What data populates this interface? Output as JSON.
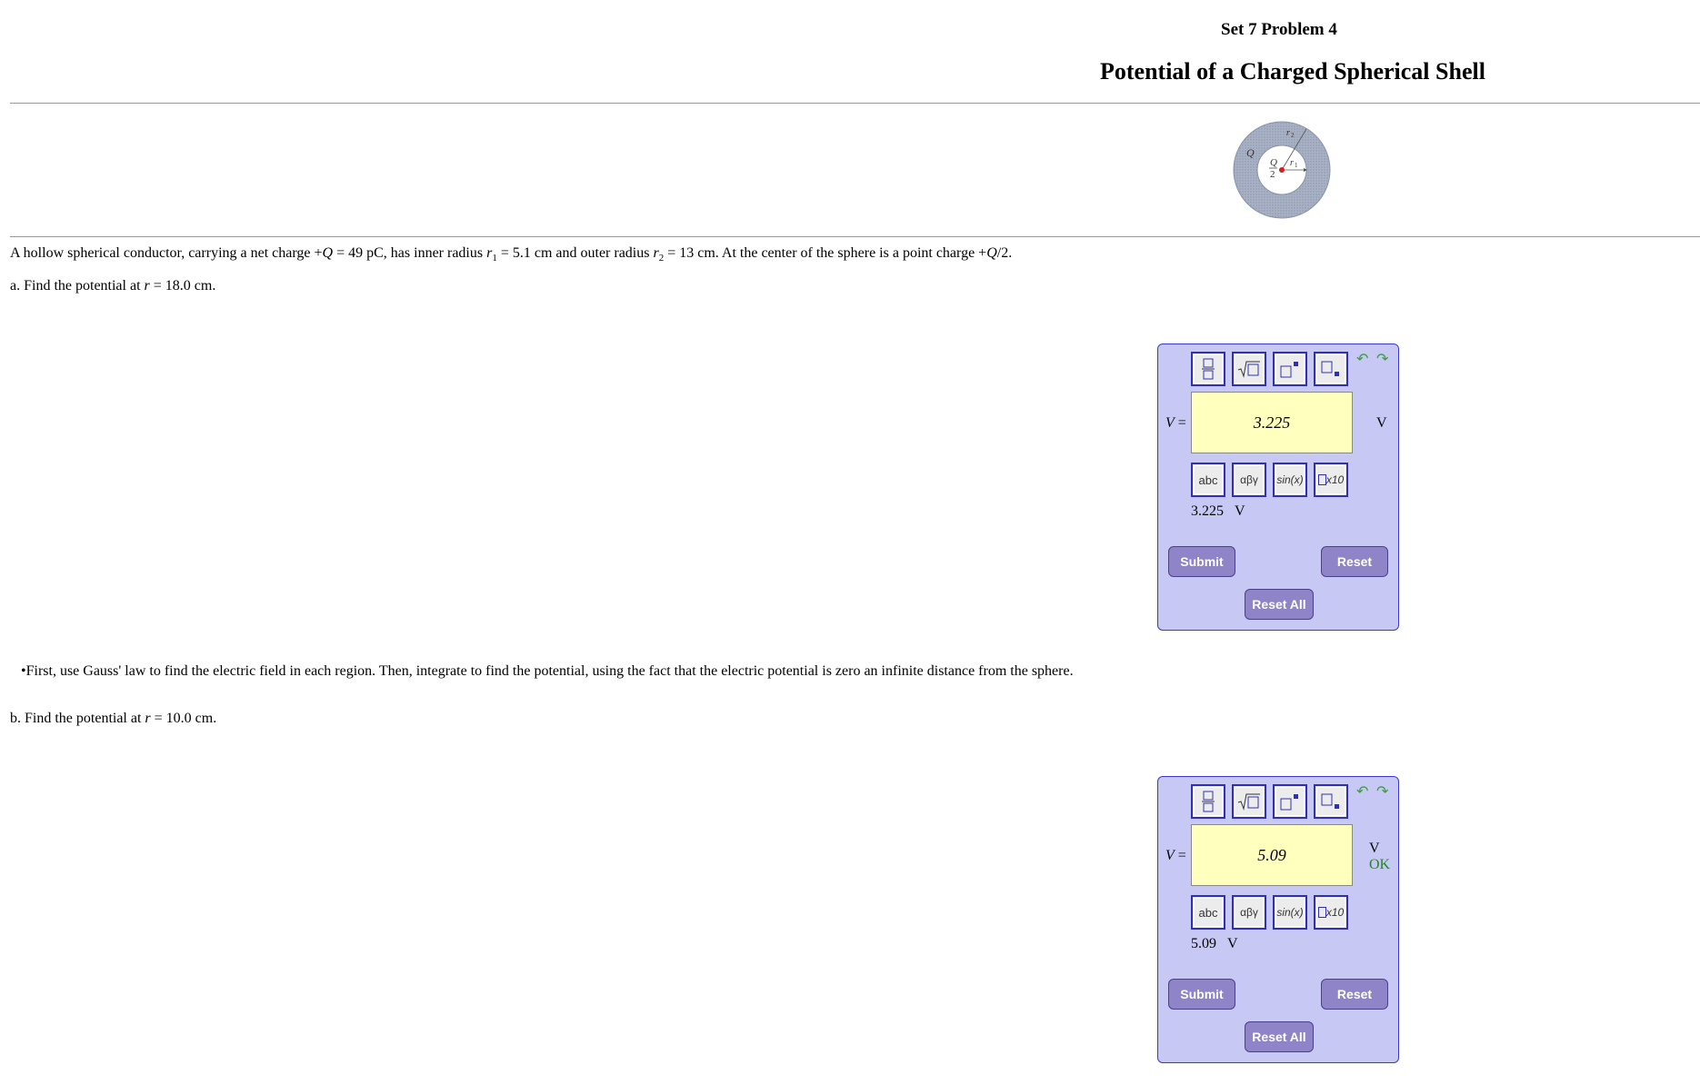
{
  "header": {
    "set_title": "Set 7 Problem 4",
    "main_title": "Potential of a Charged Spherical Shell"
  },
  "figure": {
    "label_q": "Q",
    "label_q_half_num": "Q",
    "label_q_half_den": "2",
    "label_r1": "r",
    "label_r1_sub": "1",
    "label_r2": "r",
    "label_r2_sub": "2"
  },
  "problem": {
    "p1": "A hollow spherical conductor, carrying a net charge +",
    "p2": "Q",
    "p3": " = 49 pC, has inner radius ",
    "p4": "r",
    "p5": "1",
    "p6": " = 5.1 cm and outer radius ",
    "p7": "r",
    "p8": "2",
    "p9": " = 13 cm. At the center of the sphere is a point charge +",
    "p10": "Q",
    "p11": "/2."
  },
  "part_a": {
    "prefix": "a. Find the potential at ",
    "var": "r",
    "suffix": " = 18.0 cm."
  },
  "hint": "•First, use Gauss' law to find the electric field in each region. Then, integrate to find the potential, using the fact that the electric potential is zero an infinite distance from the sphere.",
  "part_b": {
    "prefix": "b. Find the potential at ",
    "var": "r",
    "suffix": " = 10.0 cm."
  },
  "widget_a": {
    "var_label": "V",
    "equals": " =",
    "answer": "3.225",
    "unit": "V",
    "preview_value": "3.225",
    "preview_unit": "V",
    "status": ""
  },
  "widget_b": {
    "var_label": "V",
    "equals": " =",
    "answer": "5.09",
    "unit": "V",
    "preview_value": "5.09",
    "preview_unit": "V",
    "status": "OK"
  },
  "buttons": {
    "abc": "abc",
    "greek": "αβγ",
    "sin": "sin(x)",
    "sci": "x10",
    "submit": "Submit",
    "reset": "Reset",
    "reset_all": "Reset All",
    "undo": "↶",
    "redo": "↷"
  },
  "colors": {
    "widget_bg": "#c8c8f5",
    "answer_bg": "#ffffbe",
    "button_bg": "#8f84c8",
    "ok_green": "#1f8a1f"
  }
}
